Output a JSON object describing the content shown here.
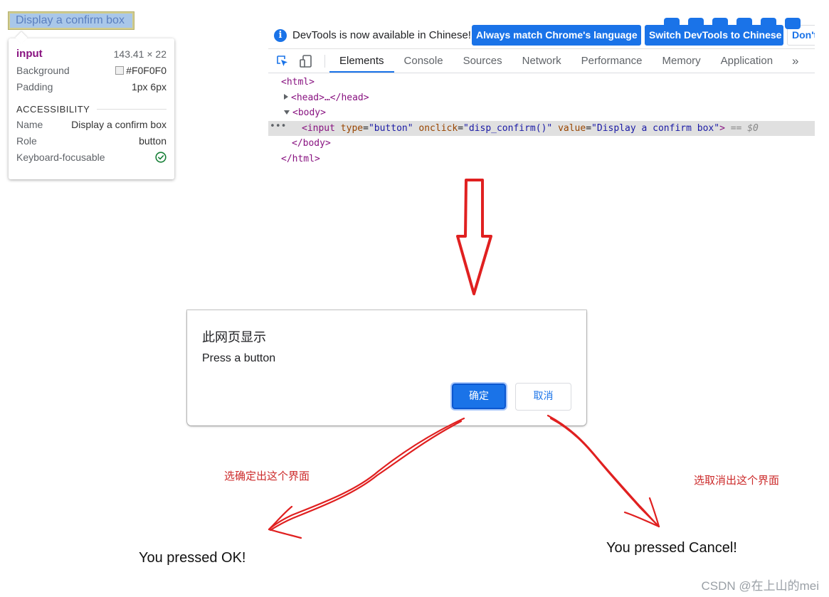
{
  "page": {
    "button_label": "Display a confirm box"
  },
  "tooltip": {
    "tag": "input",
    "size": "143.41 × 22",
    "background_label": "Background",
    "background_value": "#F0F0F0",
    "padding_label": "Padding",
    "padding_value": "1px 6px",
    "section_title": "ACCESSIBILITY",
    "name_label": "Name",
    "name_value": "Display a confirm box",
    "role_label": "Role",
    "role_value": "button",
    "focusable_label": "Keyboard-focusable",
    "swatch_color": "#F0F0F0",
    "check_color": "#188038"
  },
  "devtools": {
    "infobar_icon": "i",
    "infobar_text": "DevTools is now available in Chinese!",
    "match_button": "Always match Chrome's language",
    "switch_button": "Switch DevTools to Chinese",
    "dont_button": "Don't show again",
    "tabs": [
      {
        "label": "Elements"
      },
      {
        "label": "Console"
      },
      {
        "label": "Sources"
      },
      {
        "label": "Network"
      },
      {
        "label": "Performance"
      },
      {
        "label": "Memory"
      },
      {
        "label": "Application"
      }
    ],
    "more_tabs": "»",
    "dom": {
      "html_open": "<html>",
      "head": "<head>…</head>",
      "body_open": "<body>",
      "input_tag_open": "<input",
      "attr_type_name": "type",
      "attr_type_value": "\"button\"",
      "attr_onclick_name": "onclick",
      "attr_onclick_value": "\"disp_confirm()\"",
      "attr_value_name": "value",
      "attr_value_value": "\"Display a confirm box\"",
      "input_tag_close": ">",
      "selected_marker": "== $0",
      "ellipsis": "•••",
      "body_close": "</body>",
      "html_close": "</html>"
    },
    "accent_color": "#1a73e8"
  },
  "dialog": {
    "title": "此网页显示",
    "message": "Press a button",
    "ok_label": "确定",
    "cancel_label": "取消"
  },
  "annotations": {
    "ok_note": "选确定出这个界面",
    "cancel_note": "选取消出这个界面",
    "ok_result": "You pressed OK!",
    "cancel_result": "You pressed Cancel!",
    "arrow_color": "#e02020"
  },
  "watermark": "CSDN @在上山的mei"
}
